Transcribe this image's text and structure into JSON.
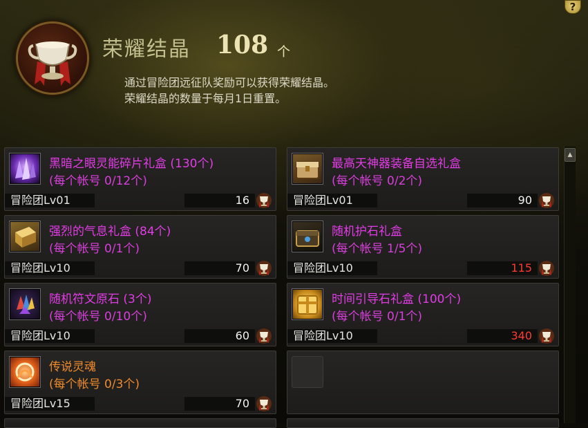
{
  "header": {
    "title": "荣耀结晶",
    "count": "108",
    "unit": "个",
    "description_lines": [
      "通过冒险团远征队奖励可以获得荣耀结晶。",
      "荣耀结晶的数量于每月1日重置。"
    ],
    "help_label": "?"
  },
  "items": [
    {
      "name": "黑暗之眼灵能碎片礼盒 (130个)",
      "limit": "(每个帐号 0/12个)",
      "level": "冒险团Lv01",
      "price": "16",
      "price_color": "#f2f2ee",
      "rarity": "epic",
      "icon": "purple-crystal-icon"
    },
    {
      "name": "最高天神器装备自选礼盒",
      "limit": "(每个帐号 0/2个)",
      "level": "冒险团Lv01",
      "price": "90",
      "price_color": "#f2f2ee",
      "rarity": "epic",
      "icon": "golden-chest-icon"
    },
    {
      "name": "强烈的气息礼盒 (84个)",
      "limit": "(每个帐号 0/1个)",
      "level": "冒险团Lv10",
      "price": "70",
      "price_color": "#f2f2ee",
      "rarity": "epic",
      "icon": "gold-box-icon"
    },
    {
      "name": "随机护石礼盒",
      "limit": "(每个帐号 1/5个)",
      "level": "冒险团Lv10",
      "price": "115",
      "price_color": "#ff3b30",
      "rarity": "epic",
      "icon": "dark-chest-icon"
    },
    {
      "name": "随机符文原石 (3个)",
      "limit": "(每个帐号 0/10个)",
      "level": "冒险团Lv10",
      "price": "60",
      "price_color": "#f2f2ee",
      "rarity": "epic",
      "icon": "rune-stone-icon"
    },
    {
      "name": "时间引导石礼盒 (100个)",
      "limit": "(每个帐号 0/1个)",
      "level": "冒险团Lv10",
      "price": "340",
      "price_color": "#ff3b30",
      "rarity": "epic",
      "icon": "glowing-box-icon"
    },
    {
      "name": "传说灵魂",
      "limit": "(每个帐号 0/3个)",
      "level": "冒险团Lv15",
      "price": "70",
      "price_color": "#f2f2ee",
      "rarity": "legendary",
      "icon": "legendary-soul-icon"
    }
  ],
  "scroll": {
    "up_arrow": "▲"
  }
}
